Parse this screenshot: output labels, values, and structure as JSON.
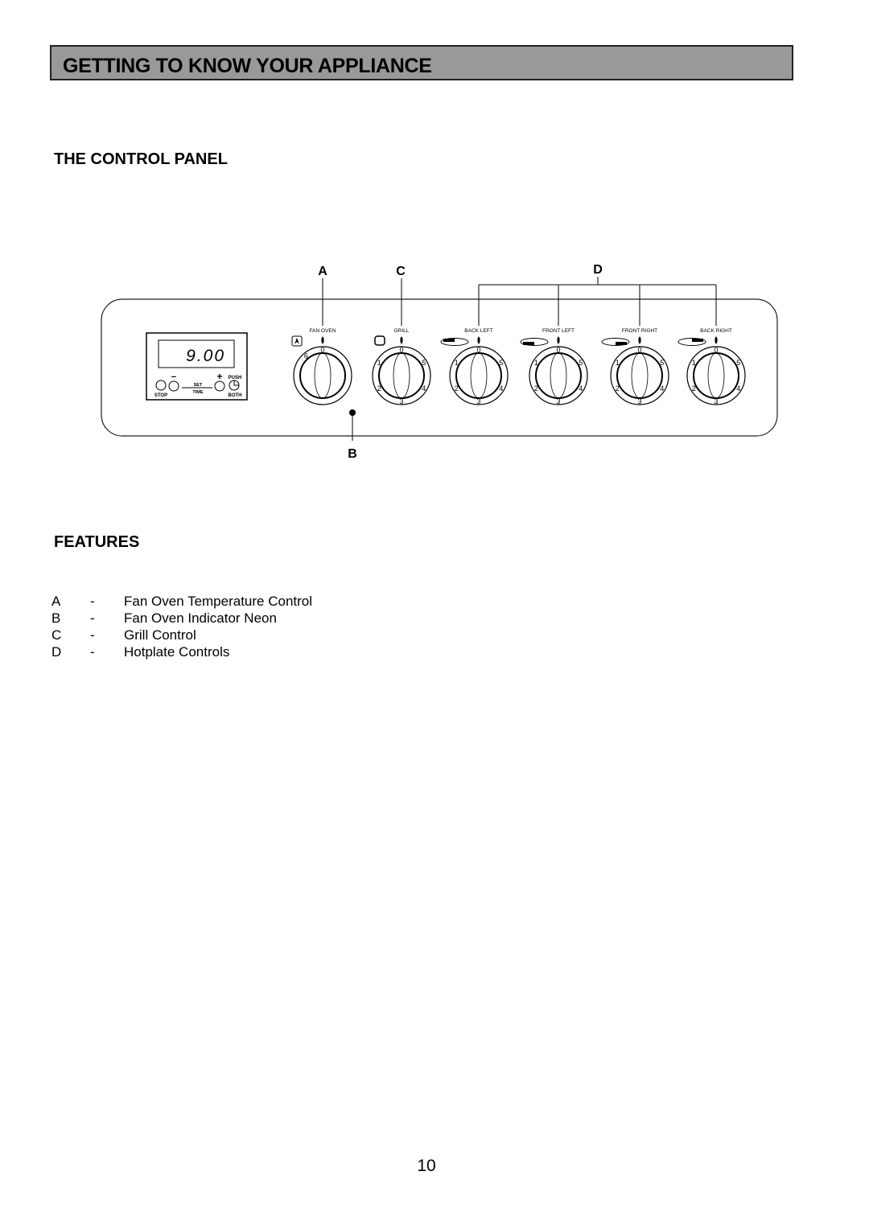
{
  "header": {
    "title": "GETTING TO KNOW YOUR APPLIANCE"
  },
  "control_panel": {
    "heading": "THE CONTROL PANEL",
    "callouts": {
      "a": "A",
      "b": "B",
      "c": "C",
      "d": "D"
    },
    "timer": {
      "display": "9.00",
      "minus": "−",
      "plus": "+",
      "set": "SET",
      "time": "TIME",
      "push": "PUSH",
      "stop": "STOP",
      "both": "BOTH",
      "icons": [
        "bell-icon",
        "clock-icon"
      ]
    },
    "knobs": [
      {
        "label": "FAN OVEN",
        "icon": "fan-icon",
        "marks": [
          "0",
          "6"
        ]
      },
      {
        "label": "GRILL",
        "icon": "grill-icon",
        "marks": [
          "0",
          "1",
          "2",
          "3",
          "4",
          "5"
        ]
      },
      {
        "label": "BACK LEFT",
        "icon": "hotplate-back-left-icon",
        "marks": [
          "0",
          "1",
          "2",
          "3",
          "4",
          "5"
        ]
      },
      {
        "label": "FRONT LEFT",
        "icon": "hotplate-front-left-icon",
        "marks": [
          "0",
          "1",
          "2",
          "3",
          "4",
          "5"
        ]
      },
      {
        "label": "FRONT RIGHT",
        "icon": "hotplate-front-right-icon",
        "marks": [
          "0",
          "1",
          "2",
          "3",
          "4",
          "5"
        ]
      },
      {
        "label": "BACK RIGHT",
        "icon": "hotplate-back-right-icon",
        "marks": [
          "0",
          "1",
          "2",
          "3",
          "4",
          "5"
        ]
      }
    ]
  },
  "features": {
    "heading": "FEATURES",
    "items": [
      {
        "key": "A",
        "sep": "-",
        "text": "Fan Oven Temperature Control"
      },
      {
        "key": "B",
        "sep": "-",
        "text": "Fan Oven Indicator Neon"
      },
      {
        "key": "C",
        "sep": "-",
        "text": "Grill Control"
      },
      {
        "key": "D",
        "sep": "-",
        "text": "Hotplate Controls"
      }
    ]
  },
  "page_number": "10"
}
